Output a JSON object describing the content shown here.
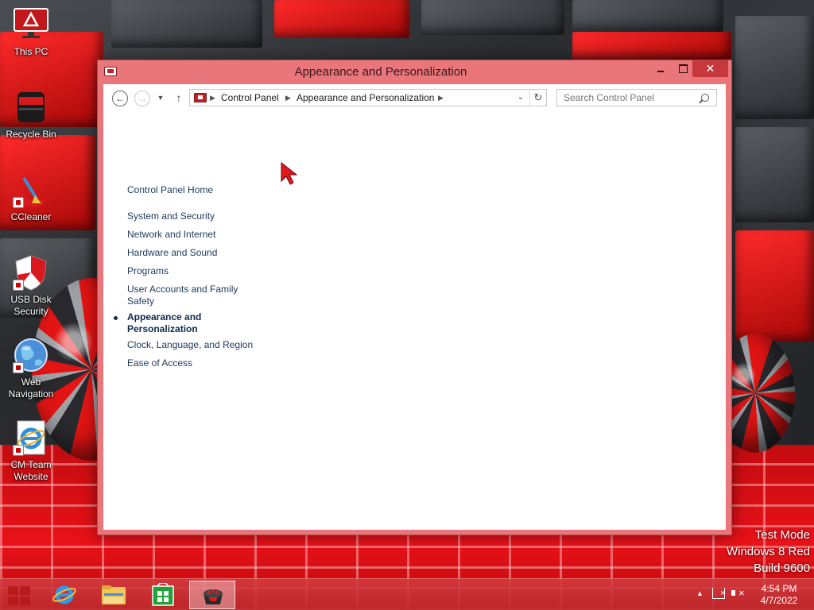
{
  "desktop": {
    "icons": [
      {
        "label": "This PC",
        "icon": "monitor-icon"
      },
      {
        "label": "Recycle Bin",
        "icon": "recycle-bin-icon"
      },
      {
        "label": "CCleaner",
        "icon": "ccleaner-icon"
      },
      {
        "label": "USB Disk Security",
        "icon": "shield-icon"
      },
      {
        "label": "Web Navigation",
        "icon": "globe-icon"
      },
      {
        "label": "CM Team Website",
        "icon": "internet-explorer-icon"
      }
    ]
  },
  "window": {
    "title": "Appearance and Personalization",
    "address": {
      "crumbs": [
        "Control Panel",
        "Appearance and Personalization"
      ]
    },
    "search": {
      "placeholder": "Search Control Panel"
    },
    "nav": {
      "home": "Control Panel Home",
      "items": [
        {
          "label": "System and Security",
          "active": false
        },
        {
          "label": "Network and Internet",
          "active": false
        },
        {
          "label": "Hardware and Sound",
          "active": false
        },
        {
          "label": "Programs",
          "active": false
        },
        {
          "label": "User Accounts and Family Safety",
          "active": false
        },
        {
          "label": "Appearance and Personalization",
          "active": true
        },
        {
          "label": "Clock, Language, and Region",
          "active": false
        },
        {
          "label": "Ease of Access",
          "active": false
        }
      ]
    }
  },
  "watermark": {
    "line1": "Test Mode",
    "line2": "Windows 8 Red",
    "line3": "Build 9600"
  },
  "taskbar": {
    "apps": [
      {
        "icon": "internet-explorer-icon",
        "active": false
      },
      {
        "icon": "file-explorer-icon",
        "active": false
      },
      {
        "icon": "store-icon",
        "active": false
      },
      {
        "icon": "control-panel-icon",
        "active": true
      }
    ],
    "clock": {
      "time": "4:54 PM",
      "date": "4/7/2022"
    }
  },
  "colors": {
    "accent": "#e8767a",
    "link": "#1e395b",
    "close": "#c7383d"
  }
}
